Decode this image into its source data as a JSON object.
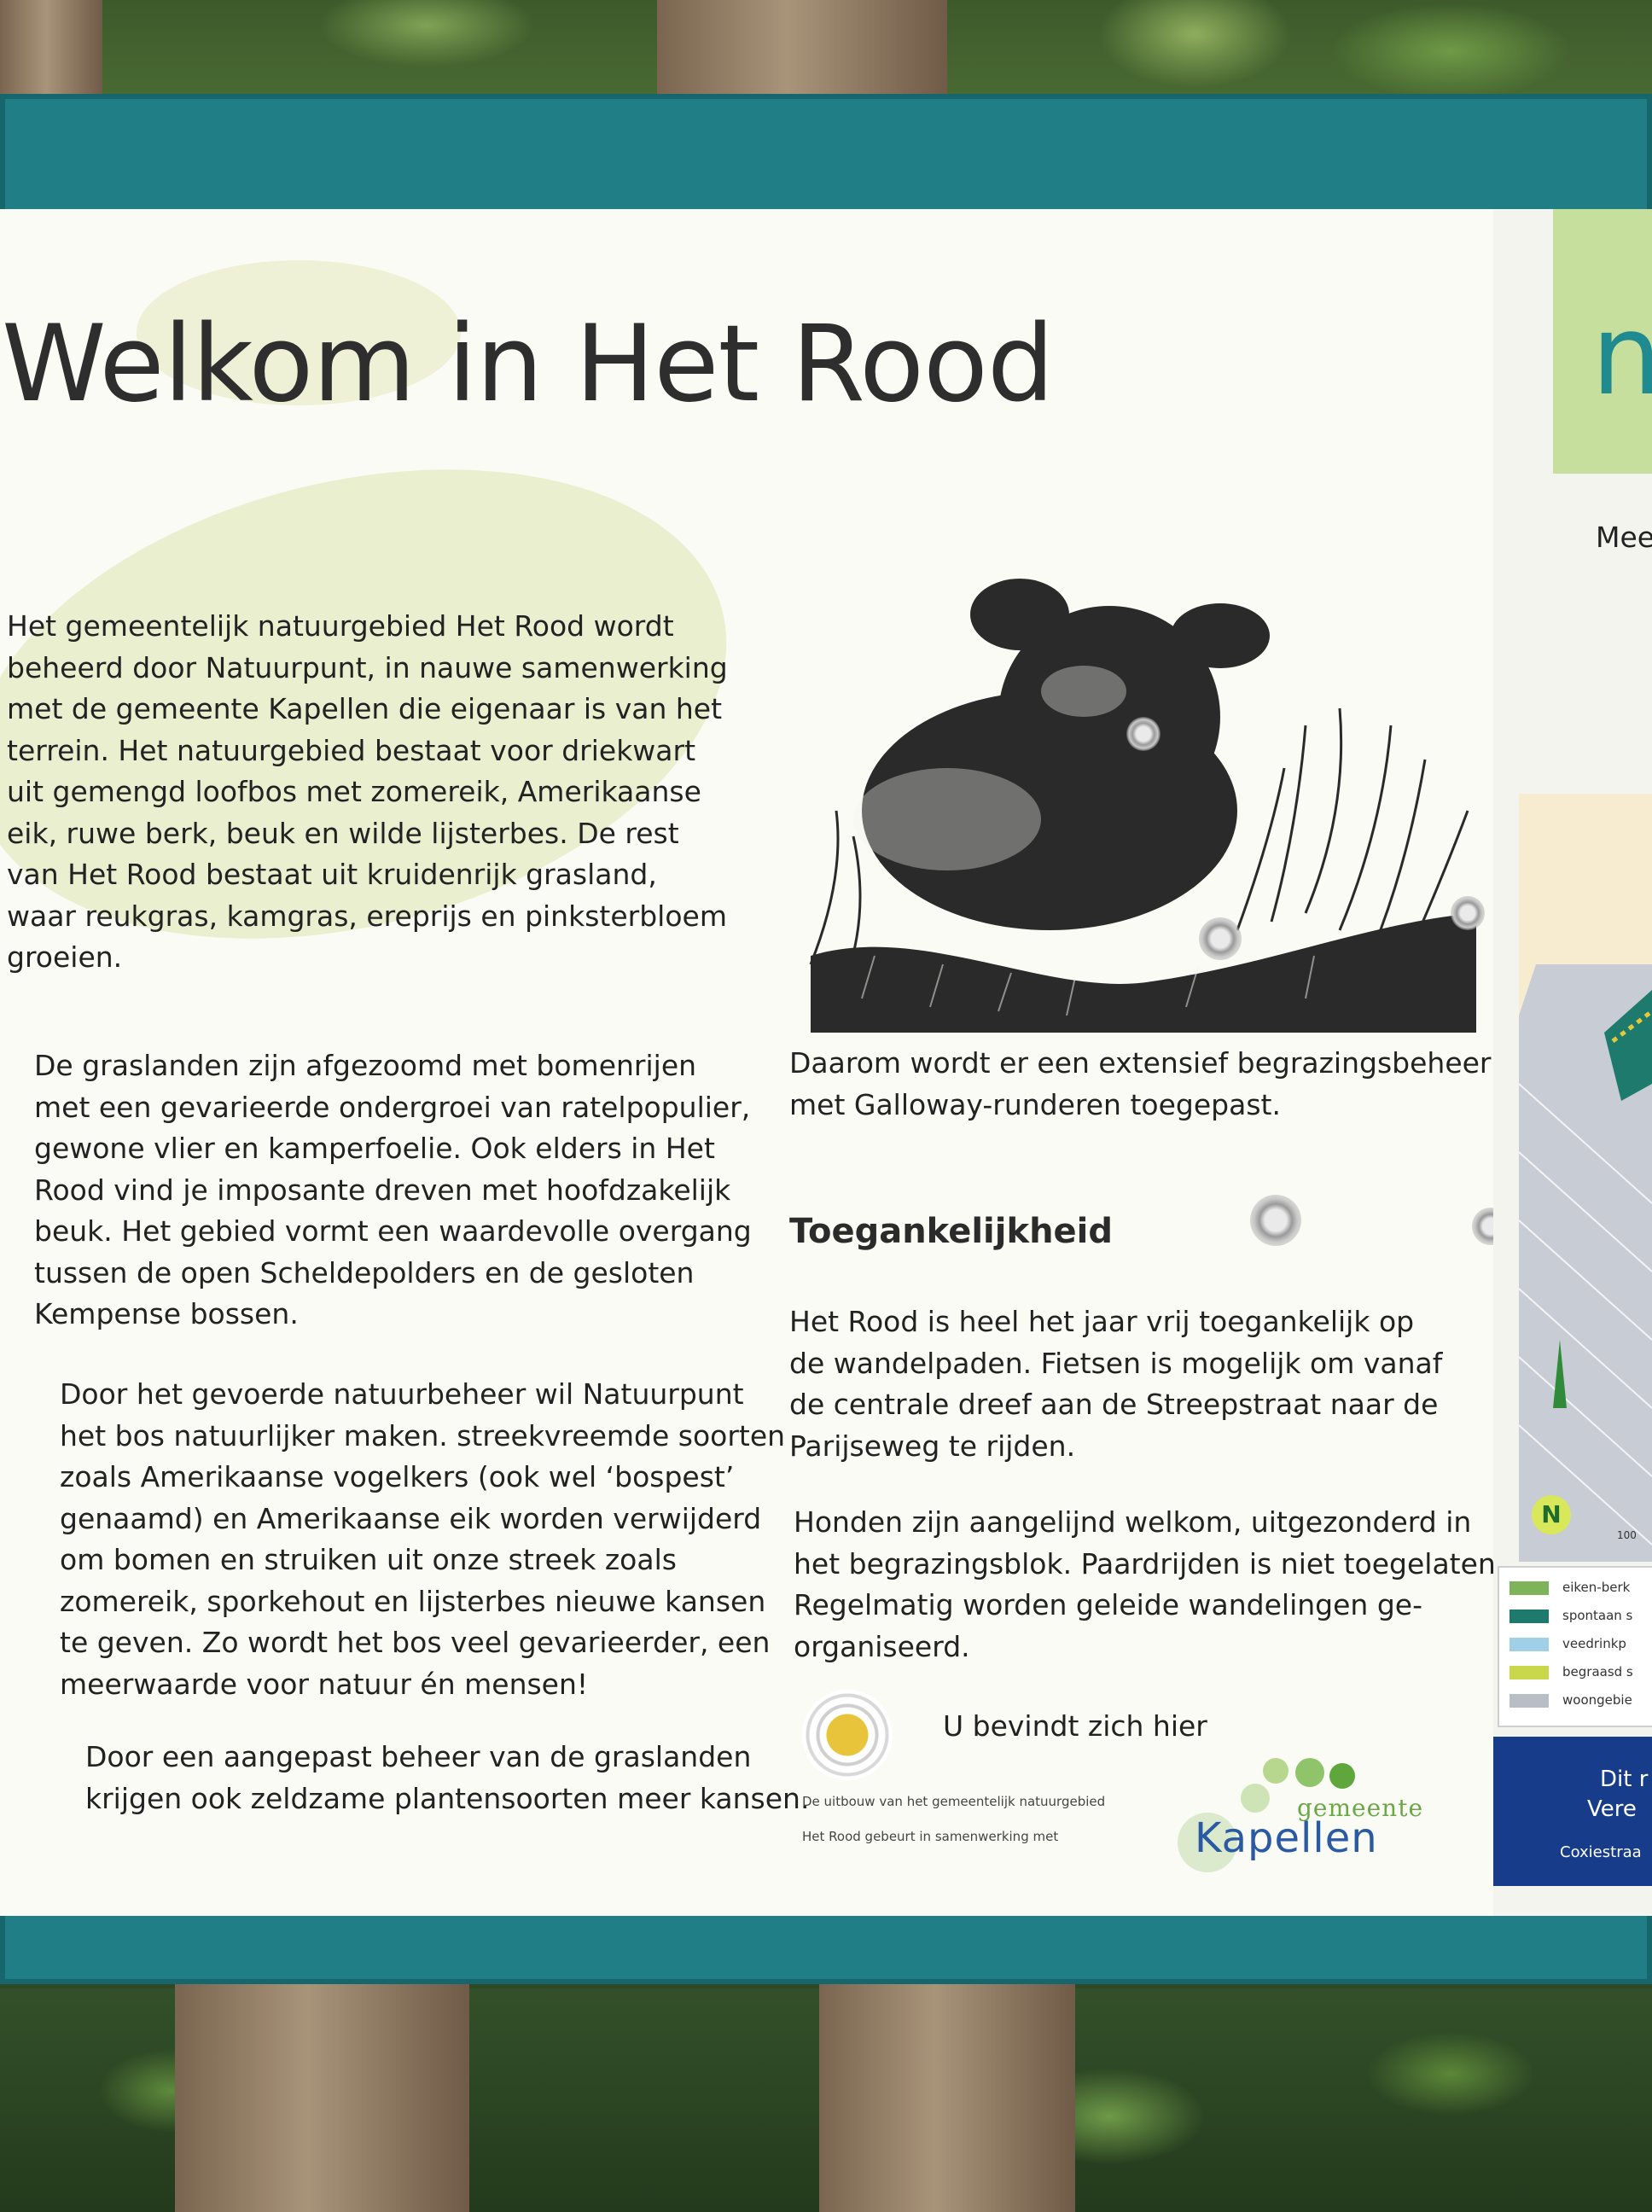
{
  "sign": {
    "title": "Welkom in Het Rood",
    "intro_lines": [
      "Het gemeentelijk natuurgebied Het Rood wordt",
      "beheerd door Natuurpunt, in nauwe samenwerking",
      "met de gemeente Kapellen die eigenaar is van het",
      "terrein. Het natuurgebied bestaat voor driekwart",
      "uit gemengd loofbos met zomereik, Amerikaanse",
      "eik, ruwe berk, beuk en wilde lijsterbes. De rest",
      "van Het Rood bestaat uit kruidenrijk grasland,",
      "waar reukgras, kamgras, ereprijs en pinksterbloem",
      "groeien."
    ],
    "grassland_lines": [
      "De graslanden zijn afgezoomd met bomenrijen",
      "met een gevarieerde ondergroei van ratelpopulier,",
      "gewone vlier en kamperfoelie. Ook elders in Het",
      "Rood vind je imposante dreven met hoofdzakelijk",
      "beuk. Het gebied vormt een waardevolle overgang",
      "tussen de open Scheldepolders en de gesloten",
      "Kempense bossen."
    ],
    "management_lines": [
      "Door het gevoerde natuurbeheer wil Natuurpunt",
      "het bos natuurlijker maken. streekvreemde soorten",
      "zoals Amerikaanse vogelkers (ook wel ‘bospest’",
      "genaamd) en Amerikaanse eik worden verwijderd",
      "om bomen en struiken uit onze streek zoals",
      "zomereik, sporkehout en lijsterbes nieuwe kansen",
      "te geven. Zo wordt het bos veel gevarieerder, een",
      "meerwaarde voor natuur én mensen!"
    ],
    "grassland_management_lines": [
      "Door een aangepast beheer van de graslanden",
      "krijgen ook zeldzame plantensoorten meer kansen."
    ],
    "grazing_lines": [
      "Daarom wordt er een extensief begrazingsbeheer",
      "met Galloway-runderen toegepast."
    ],
    "access_heading": "Toegankelijkheid",
    "access_lines": [
      "Het Rood is heel het jaar vrij toegankelijk op",
      "de wandelpaden. Fietsen is mogelijk om vanaf",
      "de centrale dreef aan de Streepstraat naar de",
      "Parijseweg te rijden."
    ],
    "dogs_lines": [
      "Honden zijn aangelijnd welkom, uitgezonderd in",
      "het begrazingsblok. Paardrijden is niet toegelaten.",
      "Regelmatig worden geleide wandelingen ge-",
      "organiseerd."
    ],
    "you_are_here": "U bevindt zich hier",
    "credit_line_1": "De uitbouw van het gemeentelijk natuurgebied",
    "credit_line_2": "Het Rood gebeurt in samenwerking met",
    "logo_small": "gemeente",
    "logo_big": "Kapellen"
  },
  "right_panel": {
    "header_letter": "n",
    "mee_text": "Mee",
    "north_label": "N",
    "scale_label": "100",
    "legend": [
      {
        "label": "eiken-berk",
        "color": "#7fb35a"
      },
      {
        "label": "spontaan s",
        "color": "#1f7a6e"
      },
      {
        "label": "veedrinkp",
        "color": "#9fd0e6"
      },
      {
        "label": "begraasd s",
        "color": "#c9d84a"
      },
      {
        "label": "woongebie",
        "color": "#b9bec6"
      }
    ],
    "footer_line_1": "Dit r",
    "footer_line_2": "Vere",
    "footer_line_3": "Coxiestraa"
  },
  "colors": {
    "frame": "#1f7e86",
    "panel": "#fbfbf6",
    "text": "#222222",
    "logo_green": "#6aa845",
    "logo_blue": "#2b5aa5",
    "footer_blue": "#173d8a"
  },
  "icons": [
    "you-are-here-icon",
    "north-arrow-icon",
    "cow-illustration",
    "kapellen-logo"
  ]
}
